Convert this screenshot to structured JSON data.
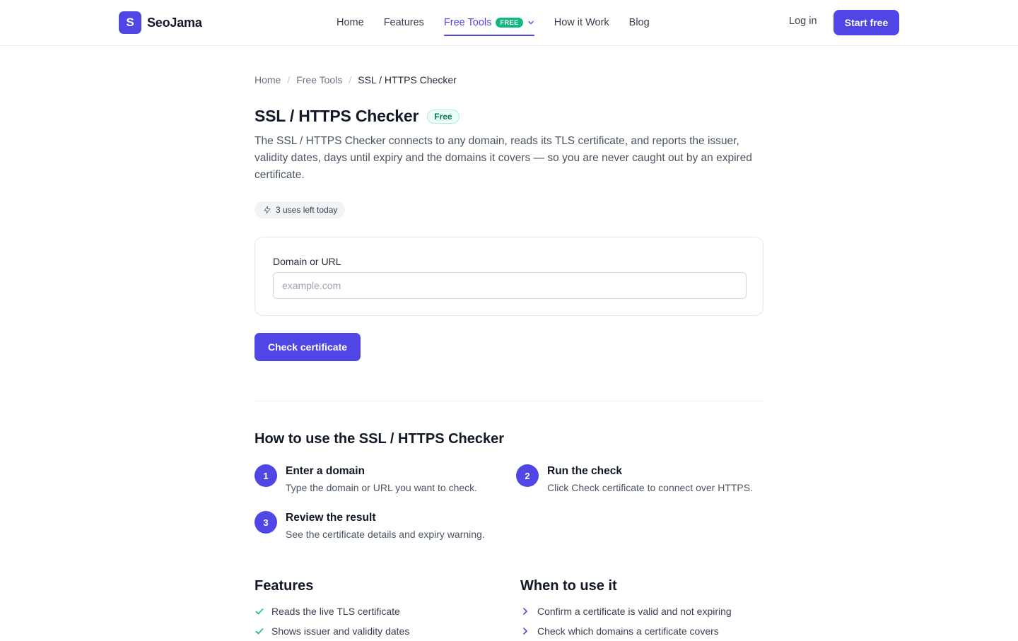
{
  "header": {
    "brand_letter": "S",
    "brand_name": "SeoJama",
    "nav": [
      {
        "label": "Home"
      },
      {
        "label": "Features"
      },
      {
        "label": "Free Tools",
        "badge": "FREE",
        "active": true
      },
      {
        "label": "How it Work"
      },
      {
        "label": "Blog"
      }
    ],
    "login_label": "Log in",
    "start_label": "Start free"
  },
  "breadcrumb": [
    "Home",
    "Free Tools",
    "SSL / HTTPS Checker"
  ],
  "page": {
    "title": "SSL / HTTPS Checker",
    "badge": "Free",
    "description": "The SSL / HTTPS Checker connects to any domain, reads its TLS certificate, and reports the issuer, validity dates, days until expiry and the domains it covers — so you are never caught out by an expired certificate.",
    "usage": "3 uses left today"
  },
  "form": {
    "label": "Domain or URL",
    "placeholder": "example.com",
    "value": "",
    "submit_label": "Check certificate"
  },
  "how_to": {
    "title": "How to use the SSL / HTTPS Checker",
    "steps": [
      {
        "num": "1",
        "title": "Enter a domain",
        "desc": "Type the domain or URL you want to check."
      },
      {
        "num": "2",
        "title": "Run the check",
        "desc": "Click Check certificate to connect over HTTPS."
      },
      {
        "num": "3",
        "title": "Review the result",
        "desc": "See the certificate details and expiry warning."
      }
    ]
  },
  "features": {
    "title": "Features",
    "items": [
      "Reads the live TLS certificate",
      "Shows issuer and validity dates"
    ]
  },
  "when": {
    "title": "When to use it",
    "items": [
      "Confirm a certificate is valid and not expiring",
      "Check which domains a certificate covers"
    ]
  },
  "colors": {
    "accent": "#4f46e5",
    "success": "#10b981"
  },
  "icons": {
    "usage": "lightning-icon",
    "nav_dropdown": "chevron-down-icon",
    "feature_bullet": "check-icon",
    "when_bullet": "chevron-right-icon"
  }
}
